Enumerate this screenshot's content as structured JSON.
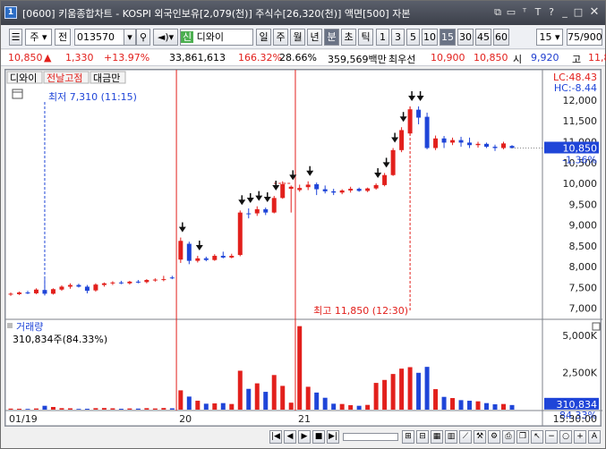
{
  "window": {
    "icon": "1",
    "title": "[0600] 키움종합차트 - KOSPI 외국인보유[2,079(천)] 주식수[26,320(천)] 액면[500] 자본"
  },
  "toolbar": {
    "period_unit": "주",
    "prev_label": "전",
    "code": "013570",
    "stock_name": "디와이",
    "stock_prefix": "신",
    "periods": [
      "일",
      "주",
      "월",
      "년",
      "분",
      "초",
      "틱"
    ],
    "active_period": "분",
    "minutes": [
      "1",
      "3",
      "5",
      "10",
      "15",
      "30",
      "45",
      "60"
    ],
    "active_minute": "15",
    "minute_select": "15",
    "count": "75",
    "total": "/900"
  },
  "infobar": {
    "price": "10,850",
    "arrow": "▲",
    "change": "1,330",
    "change_pct": "+13.97%",
    "volume": "33,861,613",
    "volume_ratio": "166.32%",
    "turnover": "28.66%",
    "amount": "359,569백만",
    "best_ask_label": "최우선",
    "best_ask": "10,900",
    "best_bid": "10,850",
    "open_label": "시",
    "open": "9,920",
    "high_label": "고",
    "high": "11,8"
  },
  "chart": {
    "legend_items": [
      "디와이",
      "전날고점",
      "대금만"
    ],
    "low_annotation": "최저 7,310 (11:15)",
    "high_annotation": "최고 11,850 (12:30)",
    "lc_label": "LC:48.43",
    "hc_label": "HC:-8.44",
    "current_price_box": "10,850",
    "current_pct_box": "-1.36%",
    "volume_title": "거래량",
    "volume_value": "310,834주(84.33%)",
    "volume_box": "310,834",
    "volume_pct_box": "84.33%",
    "x_labels": [
      "01/19",
      "20",
      "21"
    ],
    "time_label": "15:30:00",
    "colors": {
      "up": "#e2201c",
      "down": "#1f45d8",
      "separator": "#e2201c"
    }
  },
  "chart_data": {
    "type": "candlestick",
    "price_axis_ticks": [
      "12,000",
      "11,500",
      "11,000",
      "10,500",
      "10,000",
      "9,500",
      "9,000",
      "8,500",
      "8,000",
      "7,500",
      "7,000"
    ],
    "price_ylim": [
      6800,
      12300
    ],
    "volume_axis_ticks": [
      "5,000K",
      "2,500K"
    ],
    "volume_ylim": [
      0,
      5900000
    ],
    "candles": [
      {
        "o": 7330,
        "h": 7380,
        "l": 7300,
        "c": 7350,
        "v": 70000
      },
      {
        "o": 7340,
        "h": 7400,
        "l": 7320,
        "c": 7380,
        "v": 60000
      },
      {
        "o": 7380,
        "h": 7420,
        "l": 7340,
        "c": 7360,
        "v": 50000
      },
      {
        "o": 7360,
        "h": 7480,
        "l": 7340,
        "c": 7450,
        "v": 80000
      },
      {
        "o": 7440,
        "h": 7700,
        "l": 7310,
        "c": 7350,
        "v": 260000
      },
      {
        "o": 7350,
        "h": 7480,
        "l": 7330,
        "c": 7460,
        "v": 180000
      },
      {
        "o": 7450,
        "h": 7550,
        "l": 7420,
        "c": 7520,
        "v": 100000
      },
      {
        "o": 7520,
        "h": 7600,
        "l": 7470,
        "c": 7560,
        "v": 90000
      },
      {
        "o": 7560,
        "h": 7590,
        "l": 7500,
        "c": 7520,
        "v": 50000
      },
      {
        "o": 7520,
        "h": 7560,
        "l": 7360,
        "c": 7420,
        "v": 60000
      },
      {
        "o": 7430,
        "h": 7600,
        "l": 7400,
        "c": 7570,
        "v": 100000
      },
      {
        "o": 7560,
        "h": 7620,
        "l": 7520,
        "c": 7600,
        "v": 110000
      },
      {
        "o": 7600,
        "h": 7650,
        "l": 7560,
        "c": 7620,
        "v": 90000
      },
      {
        "o": 7620,
        "h": 7660,
        "l": 7580,
        "c": 7600,
        "v": 60000
      },
      {
        "o": 7600,
        "h": 7660,
        "l": 7570,
        "c": 7640,
        "v": 80000
      },
      {
        "o": 7640,
        "h": 7680,
        "l": 7600,
        "c": 7630,
        "v": 70000
      },
      {
        "o": 7630,
        "h": 7700,
        "l": 7600,
        "c": 7680,
        "v": 100000
      },
      {
        "o": 7680,
        "h": 7720,
        "l": 7640,
        "c": 7690,
        "v": 80000
      },
      {
        "o": 7690,
        "h": 7780,
        "l": 7650,
        "c": 7700,
        "v": 110000
      },
      {
        "o": 7740,
        "h": 7780,
        "l": 7700,
        "c": 7720,
        "v": 90000
      },
      {
        "o": 8170,
        "h": 8700,
        "l": 8090,
        "c": 8620,
        "v": 1300000
      },
      {
        "o": 8550,
        "h": 8600,
        "l": 8060,
        "c": 8140,
        "v": 880000
      },
      {
        "o": 8140,
        "h": 8260,
        "l": 8100,
        "c": 8200,
        "v": 600000
      },
      {
        "o": 8200,
        "h": 8240,
        "l": 8130,
        "c": 8160,
        "v": 400000
      },
      {
        "o": 8160,
        "h": 8300,
        "l": 8140,
        "c": 8260,
        "v": 420000
      },
      {
        "o": 8260,
        "h": 8360,
        "l": 8200,
        "c": 8220,
        "v": 440000
      },
      {
        "o": 8220,
        "h": 8310,
        "l": 8200,
        "c": 8260,
        "v": 380000
      },
      {
        "o": 8280,
        "h": 9350,
        "l": 8250,
        "c": 9300,
        "v": 2620000
      },
      {
        "o": 9280,
        "h": 9400,
        "l": 9160,
        "c": 9260,
        "v": 1400000
      },
      {
        "o": 9280,
        "h": 9450,
        "l": 9220,
        "c": 9380,
        "v": 1770000
      },
      {
        "o": 9380,
        "h": 9420,
        "l": 9240,
        "c": 9300,
        "v": 1200000
      },
      {
        "o": 9300,
        "h": 9700,
        "l": 9280,
        "c": 9650,
        "v": 2330000
      },
      {
        "o": 9650,
        "h": 10050,
        "l": 9630,
        "c": 9980,
        "v": 1600000
      },
      {
        "o": 9870,
        "h": 9950,
        "l": 9300,
        "c": 9920,
        "v": 470000
      },
      {
        "o": 9840,
        "h": 9970,
        "l": 9800,
        "c": 9890,
        "v": 5620000
      },
      {
        "o": 9910,
        "h": 10050,
        "l": 9840,
        "c": 9970,
        "v": 1540000
      },
      {
        "o": 9980,
        "h": 10020,
        "l": 9720,
        "c": 9860,
        "v": 1150000
      },
      {
        "o": 9860,
        "h": 9950,
        "l": 9760,
        "c": 9810,
        "v": 800000
      },
      {
        "o": 9810,
        "h": 9870,
        "l": 9720,
        "c": 9780,
        "v": 400000
      },
      {
        "o": 9780,
        "h": 9860,
        "l": 9740,
        "c": 9830,
        "v": 380000
      },
      {
        "o": 9830,
        "h": 9920,
        "l": 9780,
        "c": 9870,
        "v": 300000
      },
      {
        "o": 9870,
        "h": 9900,
        "l": 9800,
        "c": 9820,
        "v": 260000
      },
      {
        "o": 9820,
        "h": 9900,
        "l": 9790,
        "c": 9880,
        "v": 320000
      },
      {
        "o": 9880,
        "h": 10000,
        "l": 9850,
        "c": 9960,
        "v": 1800000
      },
      {
        "o": 9960,
        "h": 10250,
        "l": 9930,
        "c": 10200,
        "v": 2000000
      },
      {
        "o": 10200,
        "h": 10850,
        "l": 10180,
        "c": 10800,
        "v": 2400000
      },
      {
        "o": 10800,
        "h": 11350,
        "l": 10750,
        "c": 11280,
        "v": 2760000
      },
      {
        "o": 11200,
        "h": 11850,
        "l": 11150,
        "c": 11780,
        "v": 2860000
      },
      {
        "o": 11770,
        "h": 11850,
        "l": 11420,
        "c": 11580,
        "v": 2480000
      },
      {
        "o": 11600,
        "h": 11700,
        "l": 10820,
        "c": 10850,
        "v": 2880000
      },
      {
        "o": 10850,
        "h": 11150,
        "l": 10800,
        "c": 11080,
        "v": 1380000
      },
      {
        "o": 11080,
        "h": 11140,
        "l": 10850,
        "c": 10980,
        "v": 860000
      },
      {
        "o": 10980,
        "h": 11100,
        "l": 10920,
        "c": 11040,
        "v": 780000
      },
      {
        "o": 11040,
        "h": 11120,
        "l": 10880,
        "c": 10980,
        "v": 640000
      },
      {
        "o": 10980,
        "h": 11100,
        "l": 10850,
        "c": 10920,
        "v": 600000
      },
      {
        "o": 10920,
        "h": 11000,
        "l": 10860,
        "c": 10950,
        "v": 560000
      },
      {
        "o": 10950,
        "h": 10980,
        "l": 10850,
        "c": 10880,
        "v": 440000
      },
      {
        "o": 10880,
        "h": 10930,
        "l": 10780,
        "c": 10850,
        "v": 360000
      },
      {
        "o": 10850,
        "h": 11000,
        "l": 10820,
        "c": 10960,
        "v": 380000
      },
      {
        "o": 10900,
        "h": 10920,
        "l": 10840,
        "c": 10850,
        "v": 310834
      }
    ],
    "arrow_candle_indexes": [
      20,
      22,
      27,
      28,
      29,
      30,
      31,
      33,
      35,
      43,
      44,
      45,
      46,
      47,
      48
    ],
    "day_separator_indexes": [
      20,
      34
    ],
    "prev_high_segment": {
      "from": 31,
      "to": 33,
      "price": 10000
    },
    "low_marker_index": 4,
    "high_marker_index": 47,
    "current_price": 10850
  }
}
